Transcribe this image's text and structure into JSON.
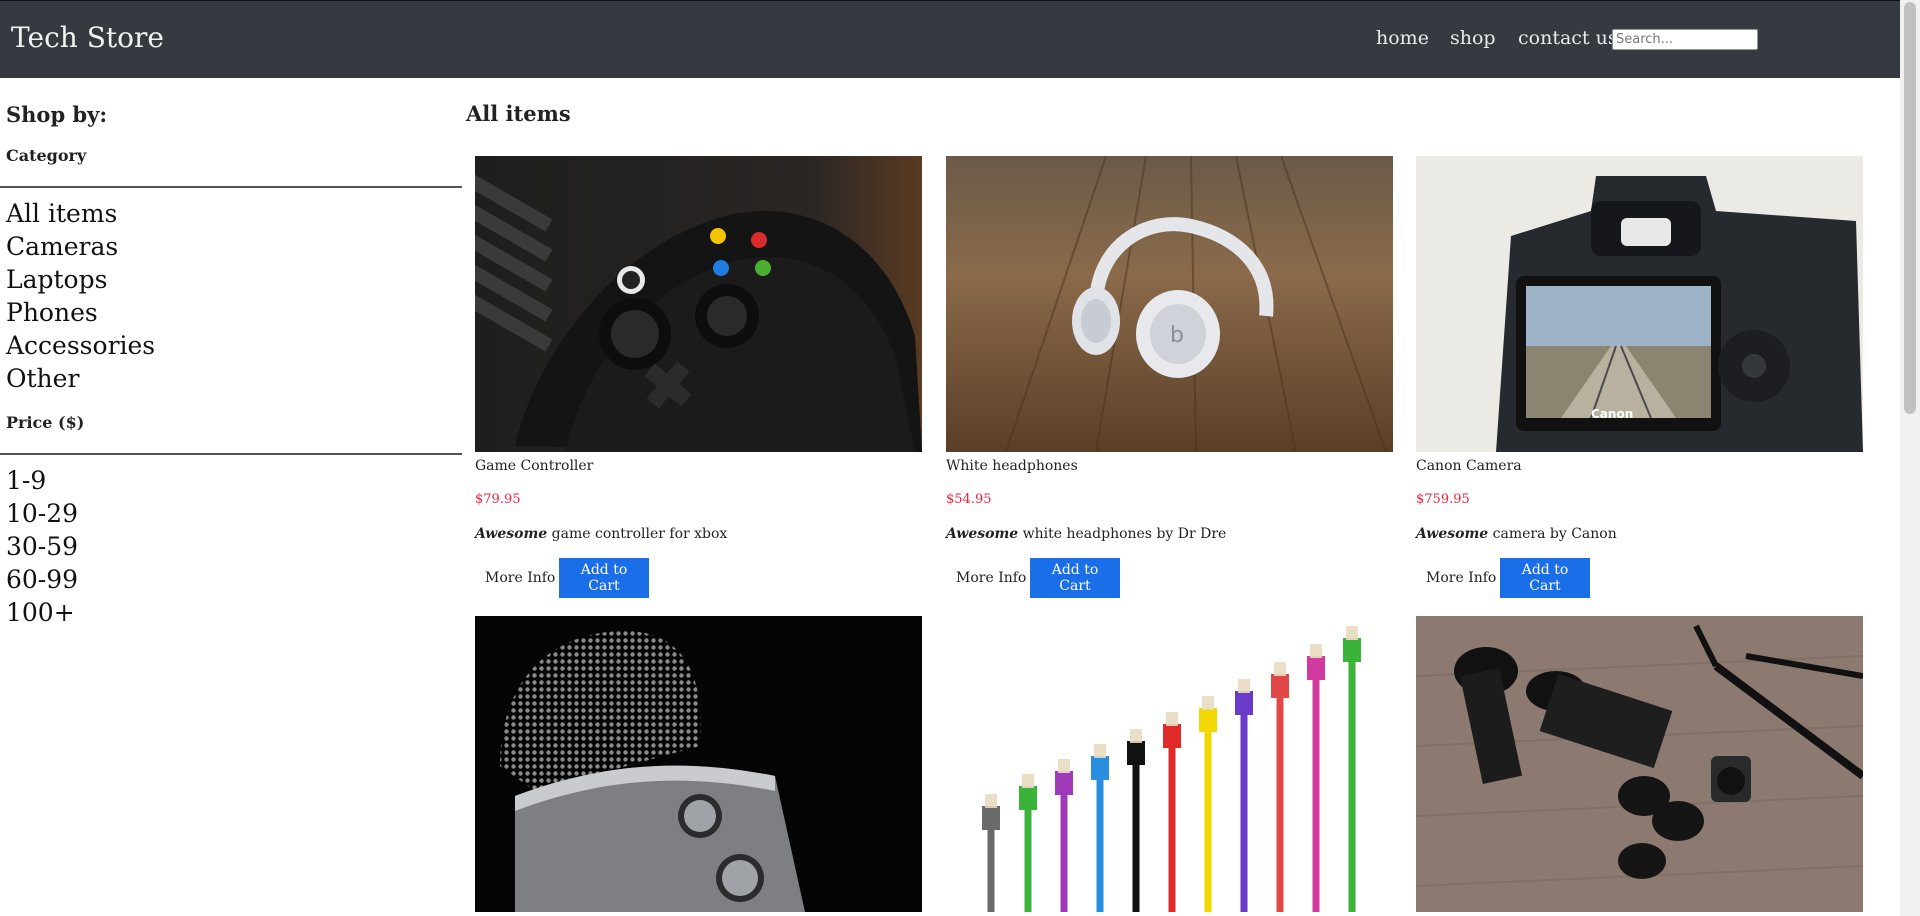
{
  "navbar": {
    "brand": "Tech Store",
    "links": [
      "home",
      "shop",
      "contact us"
    ],
    "search_placeholder": "Search..."
  },
  "sidebar": {
    "heading": "Shop by:",
    "category_title": "Category",
    "categories": [
      "All items",
      "Cameras",
      "Laptops",
      "Phones",
      "Accessories",
      "Other"
    ],
    "price_title": "Price ($)",
    "prices": [
      "1-9",
      "10-29",
      "30-59",
      "60-99",
      "100+"
    ]
  },
  "main": {
    "title": "All items",
    "products": [
      {
        "name": "Game Controller",
        "price": "$79.95",
        "desc_emph": "Awesome",
        "desc_rest": " game controller for xbox",
        "image": "game-controller-photo"
      },
      {
        "name": "White headphones",
        "price": "$54.95",
        "desc_emph": "Awesome",
        "desc_rest": " white headphones by Dr Dre",
        "image": "headphones-photo"
      },
      {
        "name": "Canon Camera",
        "price": "$759.95",
        "desc_emph": "Awesome",
        "desc_rest": " camera by Canon",
        "image": "camera-photo"
      },
      {
        "image": "microphone-photo"
      },
      {
        "image": "ethernet-cables-photo"
      },
      {
        "image": "camera-lenses-photo"
      }
    ],
    "more_info_label": "More Info",
    "add_to_cart_label": "Add to Cart"
  },
  "colors": {
    "navbar_bg": "#343a40",
    "price": "#e8233a",
    "cart_button": "#1a6ee8"
  }
}
